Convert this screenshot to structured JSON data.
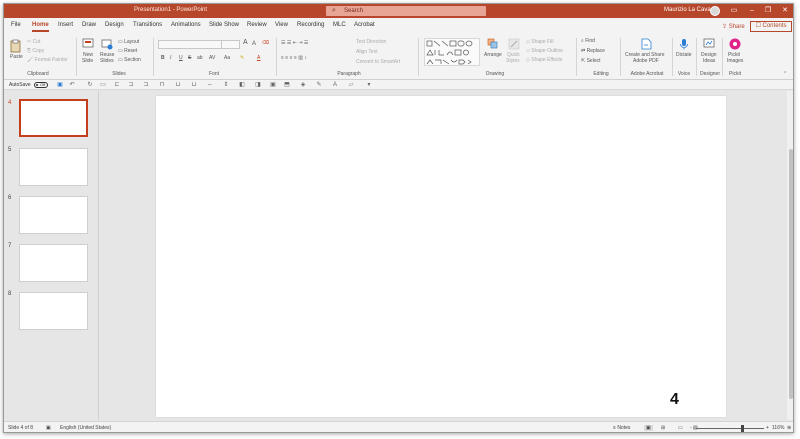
{
  "titlebar": {
    "title": "Presentation1  -  PowerPoint",
    "search_placeholder": "Search",
    "user_name": "Maurizio La Cava",
    "buttons": {
      "minimize": "–",
      "restore": "❐",
      "close": "✕",
      "options": "▭"
    }
  },
  "tabs": [
    "File",
    "Home",
    "Insert",
    "Draw",
    "Design",
    "Transitions",
    "Animations",
    "Slide Show",
    "Review",
    "View",
    "Recording",
    "MLC",
    "Acrobat"
  ],
  "tabs_right": {
    "share": "Share",
    "contents": "Contents"
  },
  "ribbon": {
    "clipboard": {
      "paste": "Paste",
      "cut": "Cut",
      "copy": "Copy",
      "format_painter": "Format Painter",
      "label": "Clipboard"
    },
    "slides": {
      "new_slide": "New",
      "new_slide2": "Slide",
      "reuse": "Reuse",
      "reuse2": "Slides",
      "layout": "Layout",
      "reset": "Reset",
      "section": "Section",
      "label": "Slides"
    },
    "font": {
      "bold": "B",
      "italic": "I",
      "underline": "U",
      "strike": "S",
      "shadow": "ab",
      "spacing": "AV",
      "case": "Aa",
      "grow": "A",
      "shrink": "A",
      "label": "Font"
    },
    "paragraph": {
      "text_direction": "Text Direction",
      "align_text": "Align Text",
      "smartart": "Convert to SmartArt",
      "label": "Paragraph"
    },
    "drawing": {
      "arrange": "Arrange",
      "quick_styles": "Quick",
      "quick_styles2": "Styles",
      "shape_fill": "Shape Fill",
      "shape_outline": "Shape Outline",
      "shape_effects": "Shape Effects",
      "label": "Drawing"
    },
    "editing": {
      "find": "Find",
      "replace": "Replace",
      "select": "Select",
      "label": "Editing"
    },
    "acrobat": {
      "create": "Create and Share",
      "create2": "Adobe PDF",
      "label": "Adobe Acrobat"
    },
    "voice": {
      "dictate": "Dictate",
      "label": "Voice"
    },
    "designer": {
      "ideas": "Design",
      "ideas2": "Ideas",
      "label": "Designer"
    },
    "pickit": {
      "images": "Pickit",
      "images2": "Images",
      "label": "Pickit"
    }
  },
  "qat": {
    "autosave": "AutoSave",
    "toggle": "Off"
  },
  "thumbnails": [
    {
      "num": "4",
      "selected": true
    },
    {
      "num": "5",
      "selected": false
    },
    {
      "num": "6",
      "selected": false
    },
    {
      "num": "7",
      "selected": false
    },
    {
      "num": "8",
      "selected": false
    }
  ],
  "slide": {
    "number_text": "4"
  },
  "status": {
    "slide_info": "Slide 4 of 8",
    "language": "English (United States)",
    "notes": "Notes",
    "zoom_minus": "-",
    "zoom_plus": "+",
    "zoom": "116%"
  },
  "colors": {
    "accent": "#b7472a",
    "selected_thumb": "#c43e1c"
  }
}
